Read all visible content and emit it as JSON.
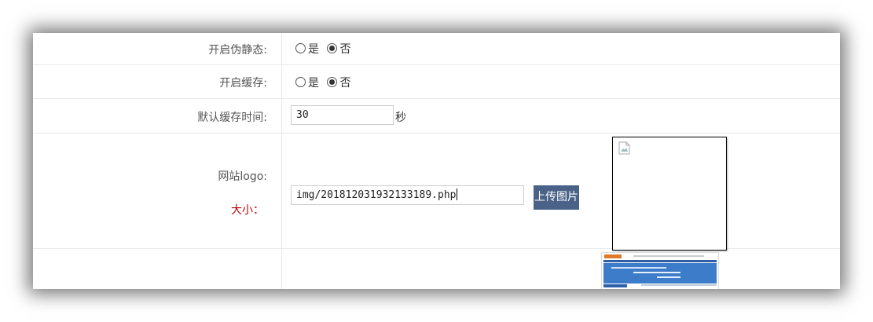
{
  "settings": {
    "rewrite": {
      "label": "开启伪静态:",
      "options": [
        "是",
        "否"
      ],
      "selected": "否"
    },
    "cache": {
      "label": "开启缓存:",
      "options": [
        "是",
        "否"
      ],
      "selected": "否"
    },
    "cache_time": {
      "label": "默认缓存时间:",
      "value": "30",
      "unit": "秒"
    },
    "logo": {
      "label": "网站logo:",
      "size_label": "大小：",
      "value": "img/201812031932133189.php",
      "upload_label": "上传图片"
    }
  },
  "colors": {
    "upload_button": "#4a6287",
    "size_label": "#c00000"
  },
  "icons": {
    "broken_image": "broken-image-icon"
  }
}
